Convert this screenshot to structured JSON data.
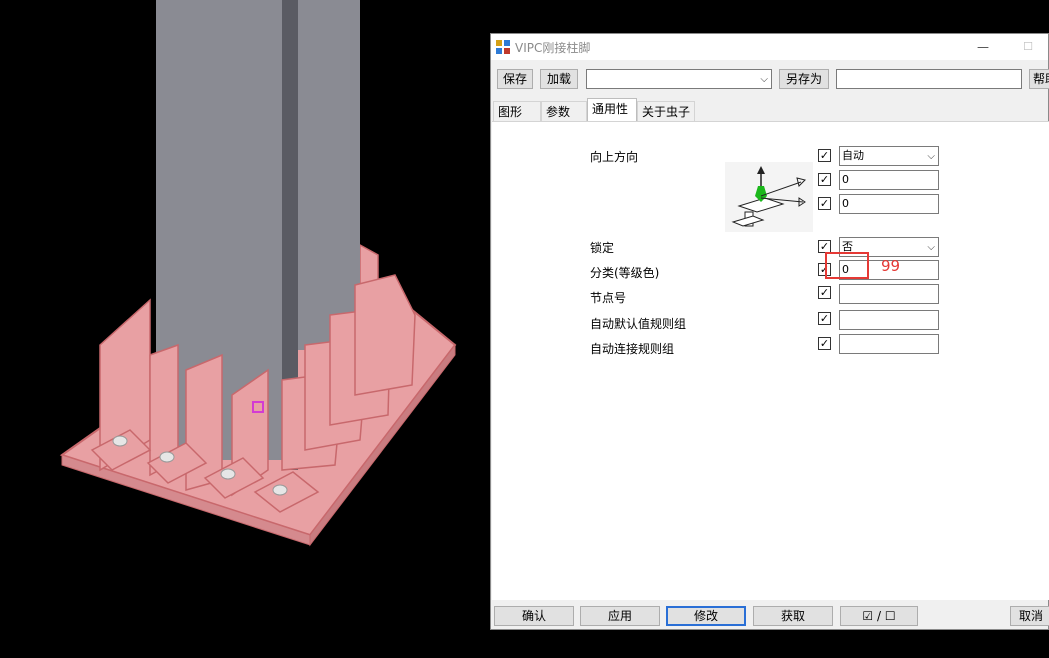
{
  "dialog": {
    "title": "VIPC刚接柱脚",
    "minimize": "—",
    "maximize": "☐"
  },
  "toolbar": {
    "save": "保存",
    "load": "加载",
    "preset_value": "",
    "save_as": "另存为",
    "save_as_name": "",
    "help": "帮助"
  },
  "tabs": [
    {
      "label": "图形"
    },
    {
      "label": "参数"
    },
    {
      "label": "通用性",
      "active": true
    },
    {
      "label": "关于虫子"
    }
  ],
  "general": {
    "up_direction_label": "向上方向",
    "up_direction_value": "自动",
    "rotation_1": "0",
    "rotation_2": "0",
    "lock_label": "锁定",
    "lock_value": "否",
    "class_label": "分类(等级色)",
    "class_value": "0",
    "node_number_label": "节点号",
    "node_number_value": "",
    "auto_defaults_label": "自动默认值规则组",
    "auto_defaults_value": "",
    "auto_connection_label": "自动连接规则组",
    "auto_connection_value": ""
  },
  "annotation": {
    "text": "99",
    "color": "#e53935"
  },
  "footer": {
    "ok": "确认",
    "apply": "应用",
    "modify": "修改",
    "get": "获取",
    "toggle_check": "☑",
    "toggle_sep": "/",
    "toggle_uncheck": "☐",
    "cancel": "取消"
  },
  "colors": {
    "column": "#8a8b93",
    "plate": "#e8a0a3",
    "plate_edge": "#c8686c",
    "background": "#000000"
  }
}
